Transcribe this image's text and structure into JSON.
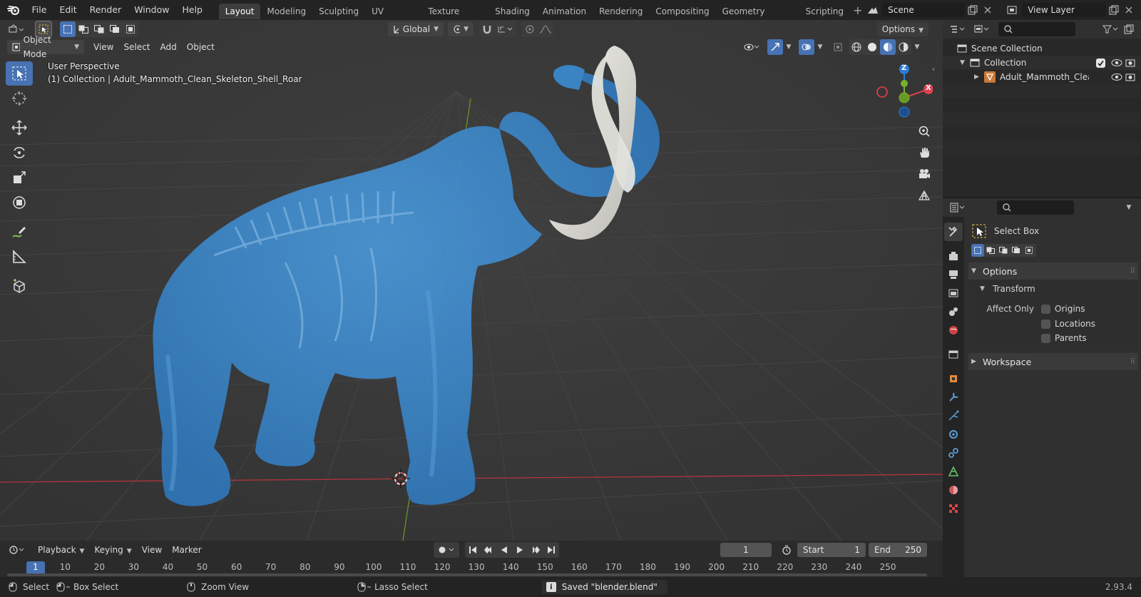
{
  "menu": [
    "File",
    "Edit",
    "Render",
    "Window",
    "Help"
  ],
  "workspaces": {
    "active": "Layout",
    "tabs": [
      "Layout",
      "Modeling",
      "Sculpting",
      "UV Editing",
      "Texture Paint",
      "Shading",
      "Animation",
      "Rendering",
      "Compositing",
      "Geometry Nodes",
      "Scripting"
    ]
  },
  "scene": {
    "name": "Scene"
  },
  "view_layer": {
    "name": "View Layer"
  },
  "viewport": {
    "transform_orientation": "Global",
    "options_label": "Options",
    "mode": "Object Mode",
    "menus": [
      "View",
      "Select",
      "Add",
      "Object"
    ],
    "overlay_title": "User Perspective",
    "overlay_collection": "(1) Collection | Adult_Mammoth_Clean_Skeleton_Shell_Roar",
    "gizmo": {
      "z": "Z",
      "x": "X"
    }
  },
  "outliner": {
    "scene_collection": "Scene Collection",
    "collection": "Collection",
    "object": "Adult_Mammoth_Clean_S"
  },
  "properties": {
    "tool_name": "Select Box",
    "options": "Options",
    "transform": "Transform",
    "affect_only": "Affect Only",
    "checks": [
      "Origins",
      "Locations",
      "Parents"
    ],
    "workspace": "Workspace"
  },
  "timeline": {
    "menus": [
      "Playback",
      "Keying",
      "View",
      "Marker"
    ],
    "current_frame": "1",
    "start_label": "Start",
    "start": "1",
    "end_label": "End",
    "end": "250",
    "frames": [
      "1",
      "10",
      "20",
      "30",
      "40",
      "50",
      "60",
      "70",
      "80",
      "90",
      "100",
      "110",
      "120",
      "130",
      "140",
      "150",
      "160",
      "170",
      "180",
      "190",
      "200",
      "210",
      "220",
      "230",
      "240",
      "250"
    ]
  },
  "status": {
    "select": "Select",
    "box_select": "Box Select",
    "zoom_view": "Zoom View",
    "lasso_select": "Lasso Select",
    "message": "Saved \"blender.blend\"",
    "version": "2.93.4"
  },
  "colors": {
    "accent": "#4772b3",
    "mesh": "#3d86c6",
    "tusk": "#dcdbd6",
    "x_axis": "#e0404f",
    "y_axis": "#79b12a",
    "z_axis": "#2f7bd6"
  }
}
